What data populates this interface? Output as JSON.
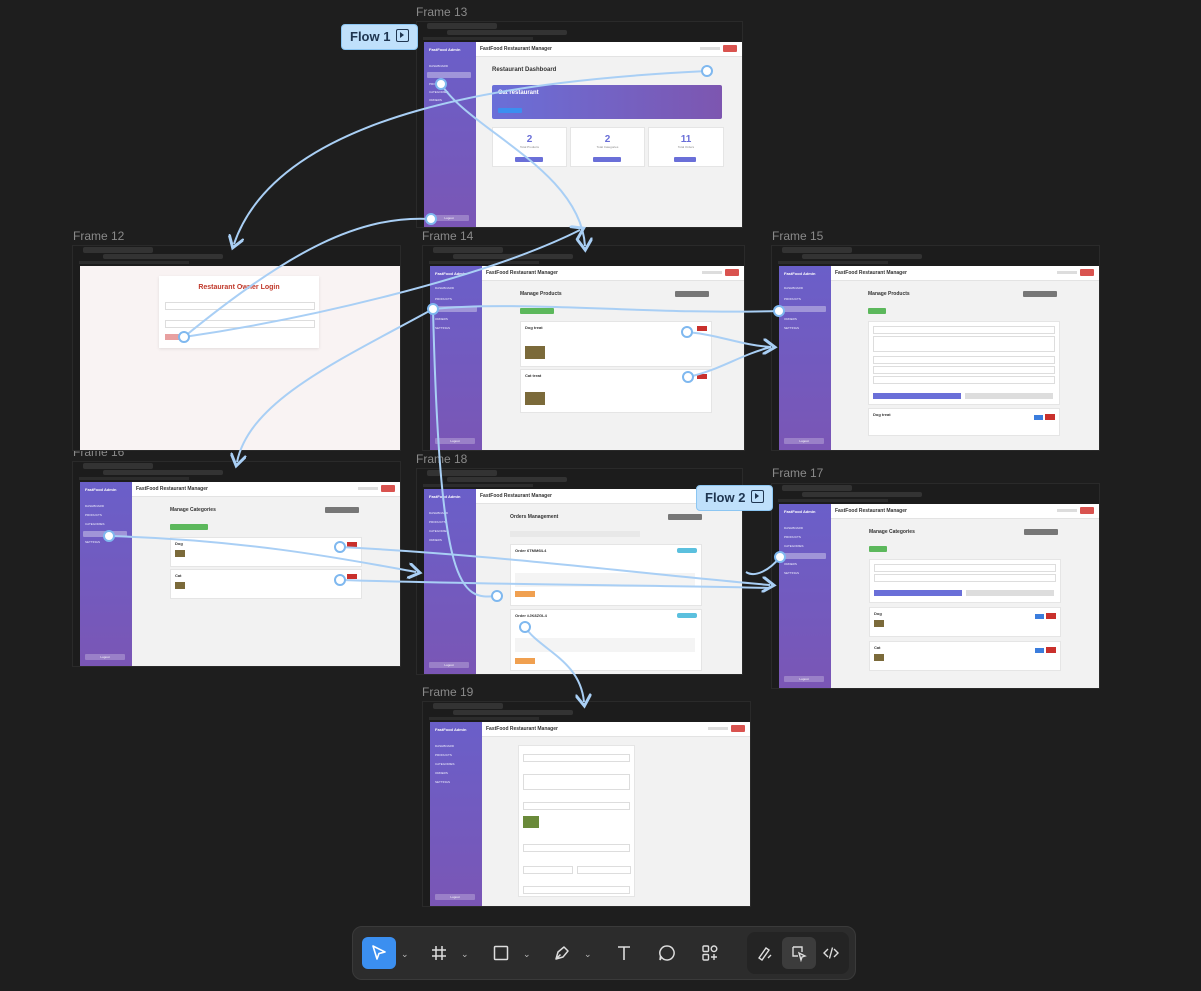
{
  "flows": [
    {
      "label": "Flow 1"
    },
    {
      "label": "Flow 2"
    }
  ],
  "app": {
    "sidebar_title": "FastFood Admin",
    "header_title": "FastFood Restaurant Manager",
    "nav": [
      "DASHBOARD",
      "PRODUCTS",
      "CATEGORIES",
      "ORDERS",
      "SETTINGS"
    ],
    "logout": "Logout"
  },
  "frames": [
    {
      "label": "Frame 13",
      "page_title": "Restaurant Dashboard",
      "banner_title": "Cat restaurant",
      "stats": [
        {
          "value": "2",
          "label": "Total Products"
        },
        {
          "value": "2",
          "label": "Total Categories"
        },
        {
          "value": "11",
          "label": "Total Orders"
        }
      ]
    },
    {
      "label": "Frame 12",
      "page_title": "Restaurant Owner Login"
    },
    {
      "label": "Frame 14",
      "page_title": "Manage Products",
      "items": [
        {
          "name": "Dog treat"
        },
        {
          "name": "Cat treat"
        }
      ]
    },
    {
      "label": "Frame 15",
      "page_title": "Manage Products",
      "items": [
        {
          "name": "Dog treat"
        }
      ]
    },
    {
      "label": "Frame 16",
      "page_title": "Manage Categories",
      "items": [
        {
          "name": "Dog"
        },
        {
          "name": "Cat"
        }
      ]
    },
    {
      "label": "Frame 18",
      "page_title": "Orders Management",
      "orders": [
        {
          "id": "Order 6TMM6IL4"
        },
        {
          "id": "Order #JK8ZGL4"
        }
      ]
    },
    {
      "label": "Frame 17",
      "page_title": "Manage Categories",
      "items": [
        {
          "name": "Dog"
        },
        {
          "name": "Cat"
        }
      ]
    },
    {
      "label": "Frame 19",
      "page_title": ""
    }
  ],
  "toolbar": {
    "tools": [
      "move-tool",
      "frame-tool",
      "shape-tool",
      "pen-tool",
      "text-tool",
      "comment-tool",
      "components-tool"
    ],
    "modes": [
      "draw-mode",
      "design-mode",
      "dev-mode"
    ]
  },
  "colors": {
    "canvas": "#1e1e1e",
    "flow_arrow": "#a9cff5",
    "sidebar_purple": "#6a5fc9",
    "accent_blue": "#3b8ff0",
    "danger_red": "#d9534f",
    "success_green": "#5cb85c"
  }
}
